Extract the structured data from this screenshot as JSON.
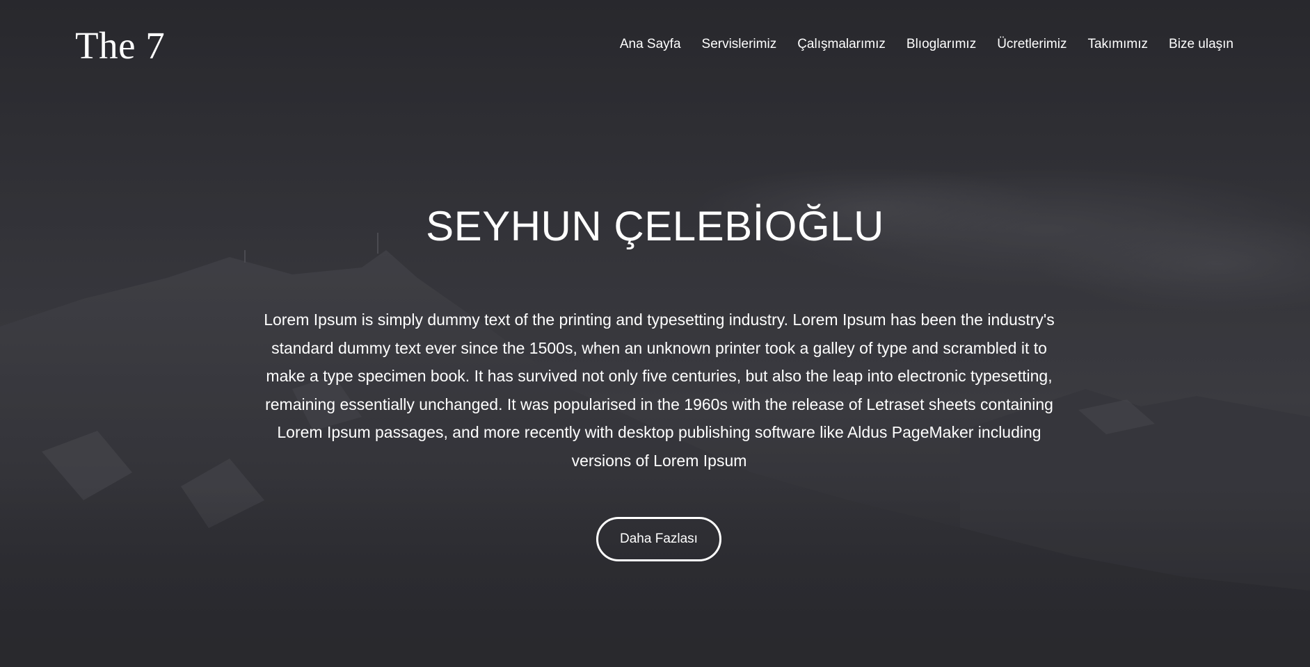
{
  "header": {
    "logo": "The 7",
    "nav": [
      {
        "label": "Ana Sayfa"
      },
      {
        "label": "Servislerimiz"
      },
      {
        "label": "Çalışmalarımız"
      },
      {
        "label": "Blıoglarımız"
      },
      {
        "label": "Ücretlerimiz"
      },
      {
        "label": "Takımımız"
      },
      {
        "label": "Bize ulaşın"
      }
    ]
  },
  "hero": {
    "title": "SEYHUN ÇELEBİOĞLU",
    "text": "Lorem Ipsum is simply dummy text of the printing and typesetting industry. Lorem Ipsum has been the industry's standard dummy text ever since the 1500s, when an unknown printer took a galley of type and scrambled it to make a type specimen book. It has survived not only five centuries, but also the leap into electronic typesetting, remaining essentially unchanged. It was popularised in the 1960s with the release of Letraset sheets containing Lorem Ipsum passages, and more recently with desktop publishing software like Aldus PageMaker including versions of Lorem Ipsum",
    "button_label": "Daha Fazlası"
  },
  "background": {
    "subject": "mountain-landscape-image",
    "overlay_color": "#2c2c31",
    "text_color": "#ffffff"
  }
}
